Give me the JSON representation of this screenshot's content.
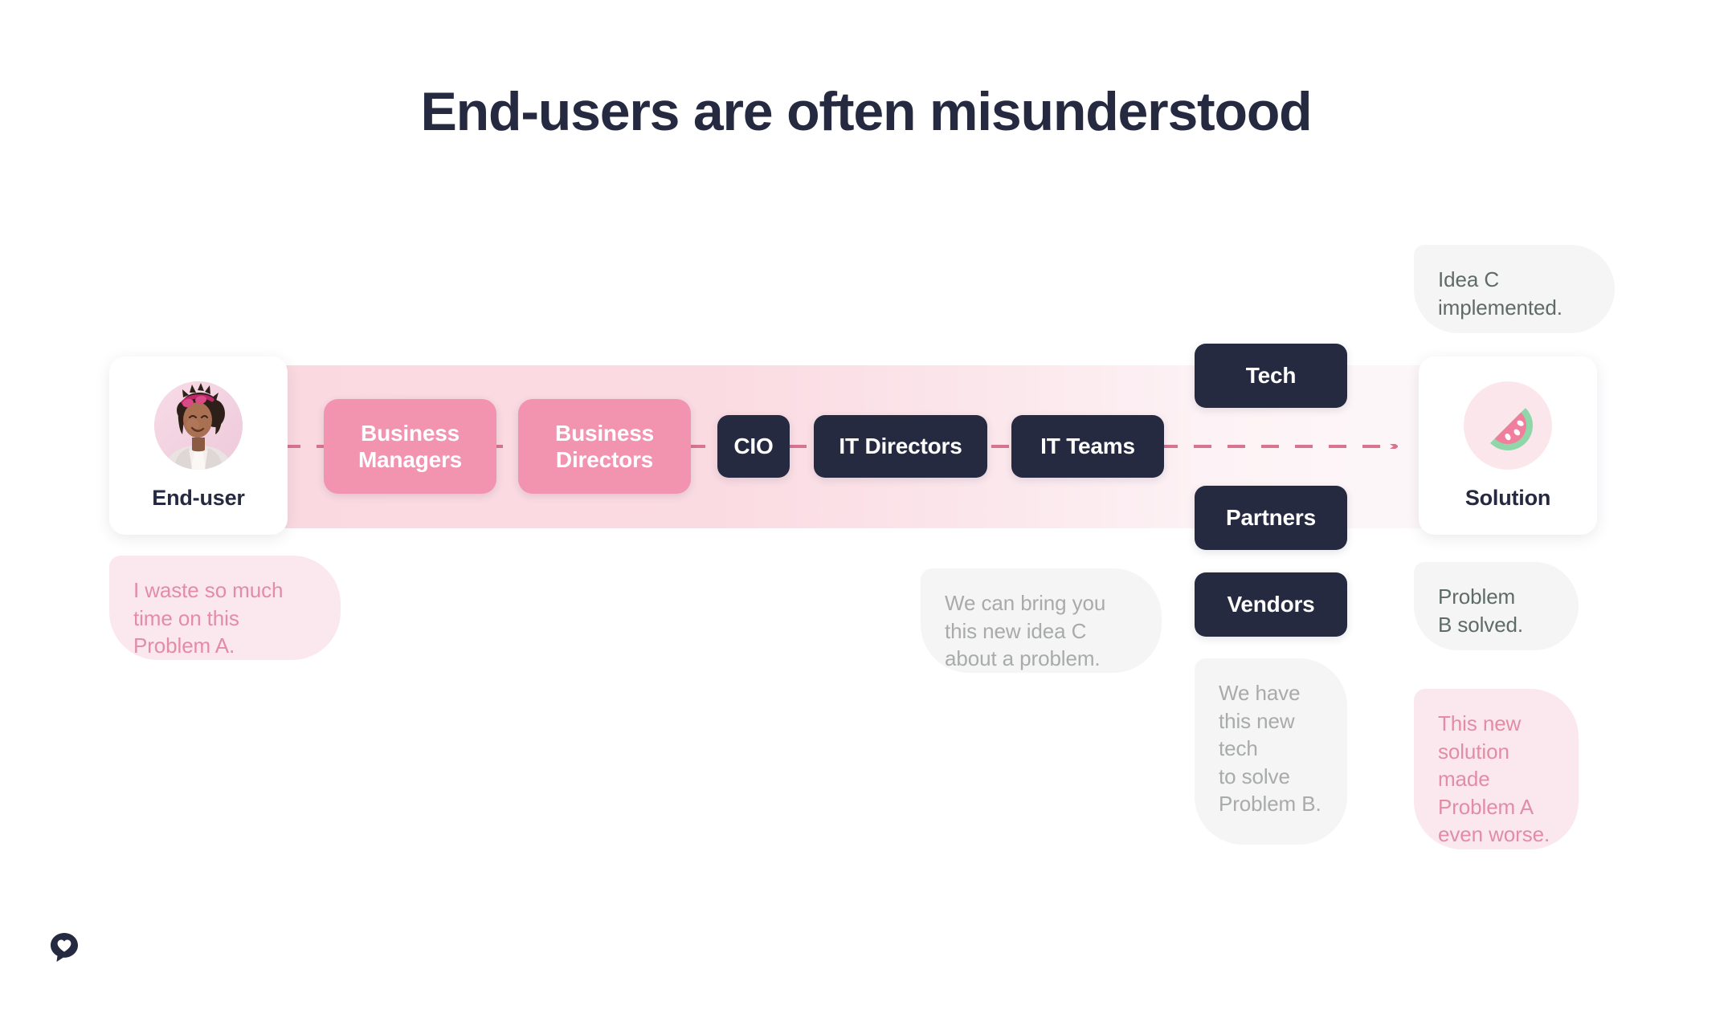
{
  "slide": {
    "title": "End-users are often misunderstood"
  },
  "colors": {
    "navy": "#252a41",
    "pink_node": "#f294b0",
    "band_pink": "#fbd9e1",
    "bubble_pink_bg": "#fbe8ee",
    "bubble_pink_text": "#e28ca7",
    "bubble_grey_bg": "#f4f5f4",
    "bubble_grey_text": "#a8aba9",
    "bubble_grey_dark_text": "#5e6b68",
    "dashed_line": "#d9748f",
    "melon_flesh": "#ef7f9d",
    "melon_rind": "#8fd6a8"
  },
  "personas": {
    "left": {
      "label": "End-user",
      "icon": "user-avatar-photo"
    },
    "right": {
      "label": "Solution",
      "icon": "watermelon-slice-icon"
    }
  },
  "chain": {
    "nodes": [
      {
        "id": "business-managers",
        "label": "Business\nManagers",
        "style": "pink"
      },
      {
        "id": "business-directors",
        "label": "Business\nDirectors",
        "style": "pink"
      },
      {
        "id": "cio",
        "label": "CIO",
        "style": "dark"
      },
      {
        "id": "it-directors",
        "label": "IT Directors",
        "style": "dark"
      },
      {
        "id": "it-teams",
        "label": "IT Teams",
        "style": "dark"
      },
      {
        "id": "tech",
        "label": "Tech",
        "style": "dark"
      },
      {
        "id": "partners",
        "label": "Partners",
        "style": "dark"
      },
      {
        "id": "vendors",
        "label": "Vendors",
        "style": "dark"
      }
    ]
  },
  "bubbles": {
    "waste": "I waste so much\ntime on this\nProblem A.",
    "idea_c": "Idea C\nimplemented.",
    "bring_idea": "We can bring you\nthis new idea C\nabout a problem.",
    "new_tech": "We have\nthis new\ntech\nto solve\nProblem B.",
    "b_solved": "Problem\nB solved.",
    "worse": "This new\nsolution\nmade\nProblem A\neven worse."
  },
  "brand": {
    "logo": "speech-bubble-heart-logo"
  }
}
